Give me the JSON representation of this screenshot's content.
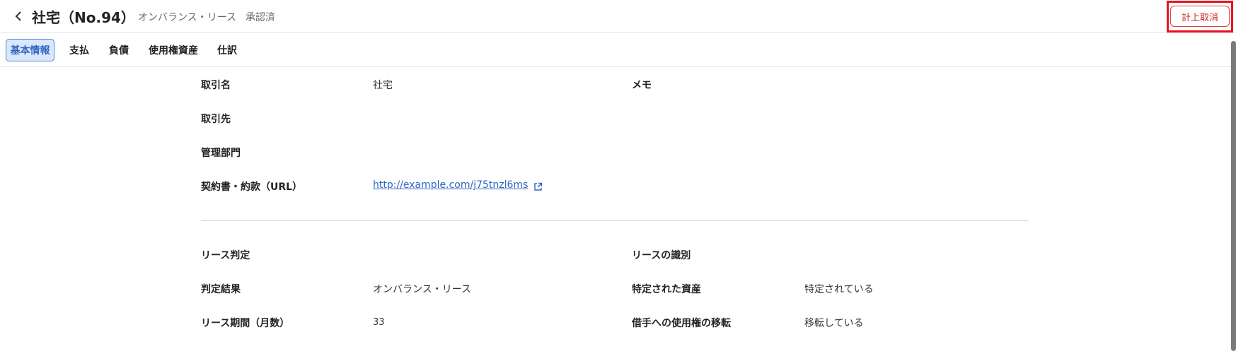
{
  "header": {
    "title": "社宅（No.94）",
    "subtitle": "オンバランス・リース",
    "status": "承認済",
    "cancel_label": "計上取消"
  },
  "tabs": [
    {
      "label": "基本情報",
      "active": true
    },
    {
      "label": "支払",
      "active": false
    },
    {
      "label": "負債",
      "active": false
    },
    {
      "label": "使用権資産",
      "active": false
    },
    {
      "label": "仕訳",
      "active": false
    }
  ],
  "basic": {
    "name_label": "取引名",
    "name_value": "社宅",
    "memo_label": "メモ",
    "partner_label": "取引先",
    "dept_label": "管理部門",
    "contract_label": "契約書・約款（URL）",
    "contract_url": "http://example.com/j75tnzl6ms"
  },
  "lease": {
    "judgment_label": "リース判定",
    "identification_label": "リースの識別",
    "result_label": "判定結果",
    "result_value": "オンバランス・リース",
    "asset_label": "特定された資産",
    "asset_value": "特定されている",
    "period_label": "リース期間（月数）",
    "period_value": "33",
    "transfer_label": "借手への使用権の移転",
    "transfer_value": "移転している"
  },
  "colors": {
    "accent": "#2f66c4",
    "tab_active_bg": "#dbe8fb",
    "danger": "#c62828",
    "highlight": "#e8141c"
  }
}
